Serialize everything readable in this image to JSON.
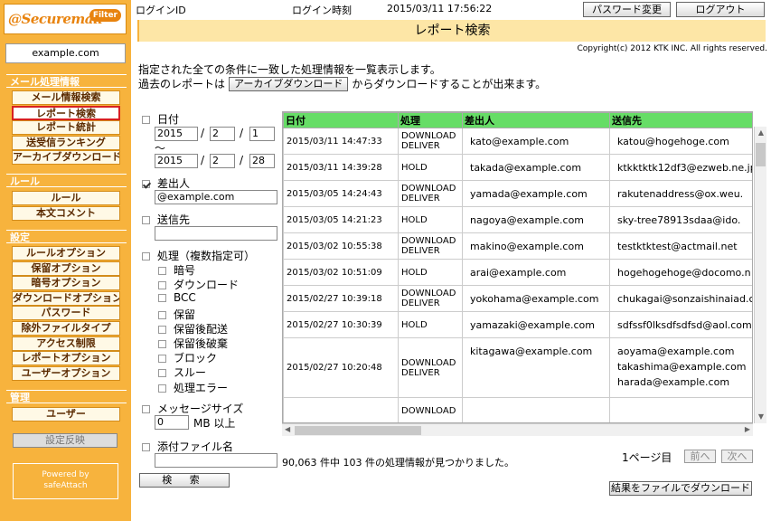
{
  "sidebar": {
    "logo_text": "@Securemail",
    "logo_badge": "Filter",
    "domain": "example.com",
    "sections": {
      "mail": "メール処理情報",
      "rule": "ルール",
      "settings": "設定",
      "admin": "管理"
    },
    "mail_items": [
      "メール情報検索",
      "レポート検索",
      "レポート統計",
      "送受信ランキング",
      "アーカイブダウンロード"
    ],
    "rule_items": [
      "ルール",
      "本文コメント"
    ],
    "settings_items": [
      "ルールオプション",
      "保留オプション",
      "暗号オプション",
      "ダウンロードオプション",
      "パスワード",
      "除外ファイルタイプ",
      "アクセス制限",
      "レポートオプション",
      "ユーザーオプション"
    ],
    "admin_items": [
      "ユーザー"
    ],
    "apply_label": "設定反映",
    "powered_line1": "Powered by",
    "powered_line2": "safeAttach"
  },
  "header": {
    "login_id_label": "ログインID",
    "login_time_label": "ログイン時刻",
    "login_time": "2015/03/11 17:56:22",
    "password_button": "パスワード変更",
    "logout_button": "ログアウト",
    "title": "レポート検索",
    "copyright": "Copyright(c) 2012 KTK INC. All rights reserved."
  },
  "description": {
    "line1": "指定された全ての条件に一致した処理情報を一覧表示します。",
    "line2_pre": "過去のレポートは",
    "archive_button": "アーカイブダウンロード",
    "line2_post": "からダウンロードすることが出来ます。"
  },
  "filter": {
    "date_label": "日付",
    "from_year": "2015",
    "from_month": "2",
    "from_day": "1",
    "tilde": "～",
    "to_year": "2015",
    "to_month": "2",
    "to_day": "28",
    "slash": "/",
    "sender_label": "差出人",
    "sender_value": "@example.com",
    "recipient_label": "送信先",
    "recipient_value": "",
    "process_label": "処理（複数指定可）",
    "process_options": [
      "暗号",
      "ダウンロード",
      "BCC",
      "保留",
      "保留後配送",
      "保留後破棄",
      "ブロック",
      "スルー",
      "処理エラー"
    ],
    "size_label": "メッセージサイズ",
    "size_value": "0",
    "size_unit": "MB 以上",
    "attach_label": "添付ファイル名",
    "attach_value": "",
    "search_button": "検 索"
  },
  "table": {
    "columns": [
      "日付",
      "処理",
      "差出人",
      "送信先"
    ],
    "rows": [
      {
        "date": "2015/03/11 14:47:33",
        "action": [
          "DOWNLOAD",
          "DELIVER"
        ],
        "from": "kato@example.com",
        "to": [
          "katou@hogehoge.com"
        ]
      },
      {
        "date": "2015/03/11 14:39:28",
        "action": [
          "HOLD"
        ],
        "from": "takada@example.com",
        "to": [
          "ktkktktk12df3@ezweb.ne.jp"
        ]
      },
      {
        "date": "2015/03/05 14:24:43",
        "action": [
          "DOWNLOAD",
          "DELIVER"
        ],
        "from": "yamada@example.com",
        "to": [
          "rakutenaddress@ox.weu."
        ]
      },
      {
        "date": "2015/03/05 14:21:23",
        "action": [
          "HOLD"
        ],
        "from": "nagoya@example.com",
        "to": [
          "sky-tree78913sdaa@ido."
        ]
      },
      {
        "date": "2015/03/02 10:55:38",
        "action": [
          "DOWNLOAD",
          "DELIVER"
        ],
        "from": "makino@example.com",
        "to": [
          "testktktest@actmail.net"
        ]
      },
      {
        "date": "2015/03/02 10:51:09",
        "action": [
          "HOLD"
        ],
        "from": "arai@example.com",
        "to": [
          "hogehogehoge@docomo.n"
        ]
      },
      {
        "date": "2015/02/27 10:39:18",
        "action": [
          "DOWNLOAD",
          "DELIVER"
        ],
        "from": "yokohama@example.com",
        "to": [
          "chukagai@sonzaishinaiad.c"
        ]
      },
      {
        "date": "2015/02/27 10:30:39",
        "action": [
          "HOLD"
        ],
        "from": "yamazaki@example.com",
        "to": [
          "sdfssf0lksdfsdfsd@aol.com"
        ]
      },
      {
        "date": "2015/02/27 10:20:48",
        "action": [
          "DOWNLOAD",
          "DELIVER"
        ],
        "from": "kitagawa@example.com",
        "to": [
          "aoyama@example.com",
          "takashima@example.com",
          "harada@example.com"
        ]
      },
      {
        "date": "",
        "action": [
          "DOWNLOAD"
        ],
        "from": "",
        "to": [
          ""
        ]
      }
    ]
  },
  "results": {
    "count_text": "90,063 件中 103 件の処理情報が見つかりました。",
    "page_text": "1ページ目",
    "prev_button": "前へ",
    "next_button": "次へ",
    "download_button": "結果をファイルでダウンロード"
  }
}
